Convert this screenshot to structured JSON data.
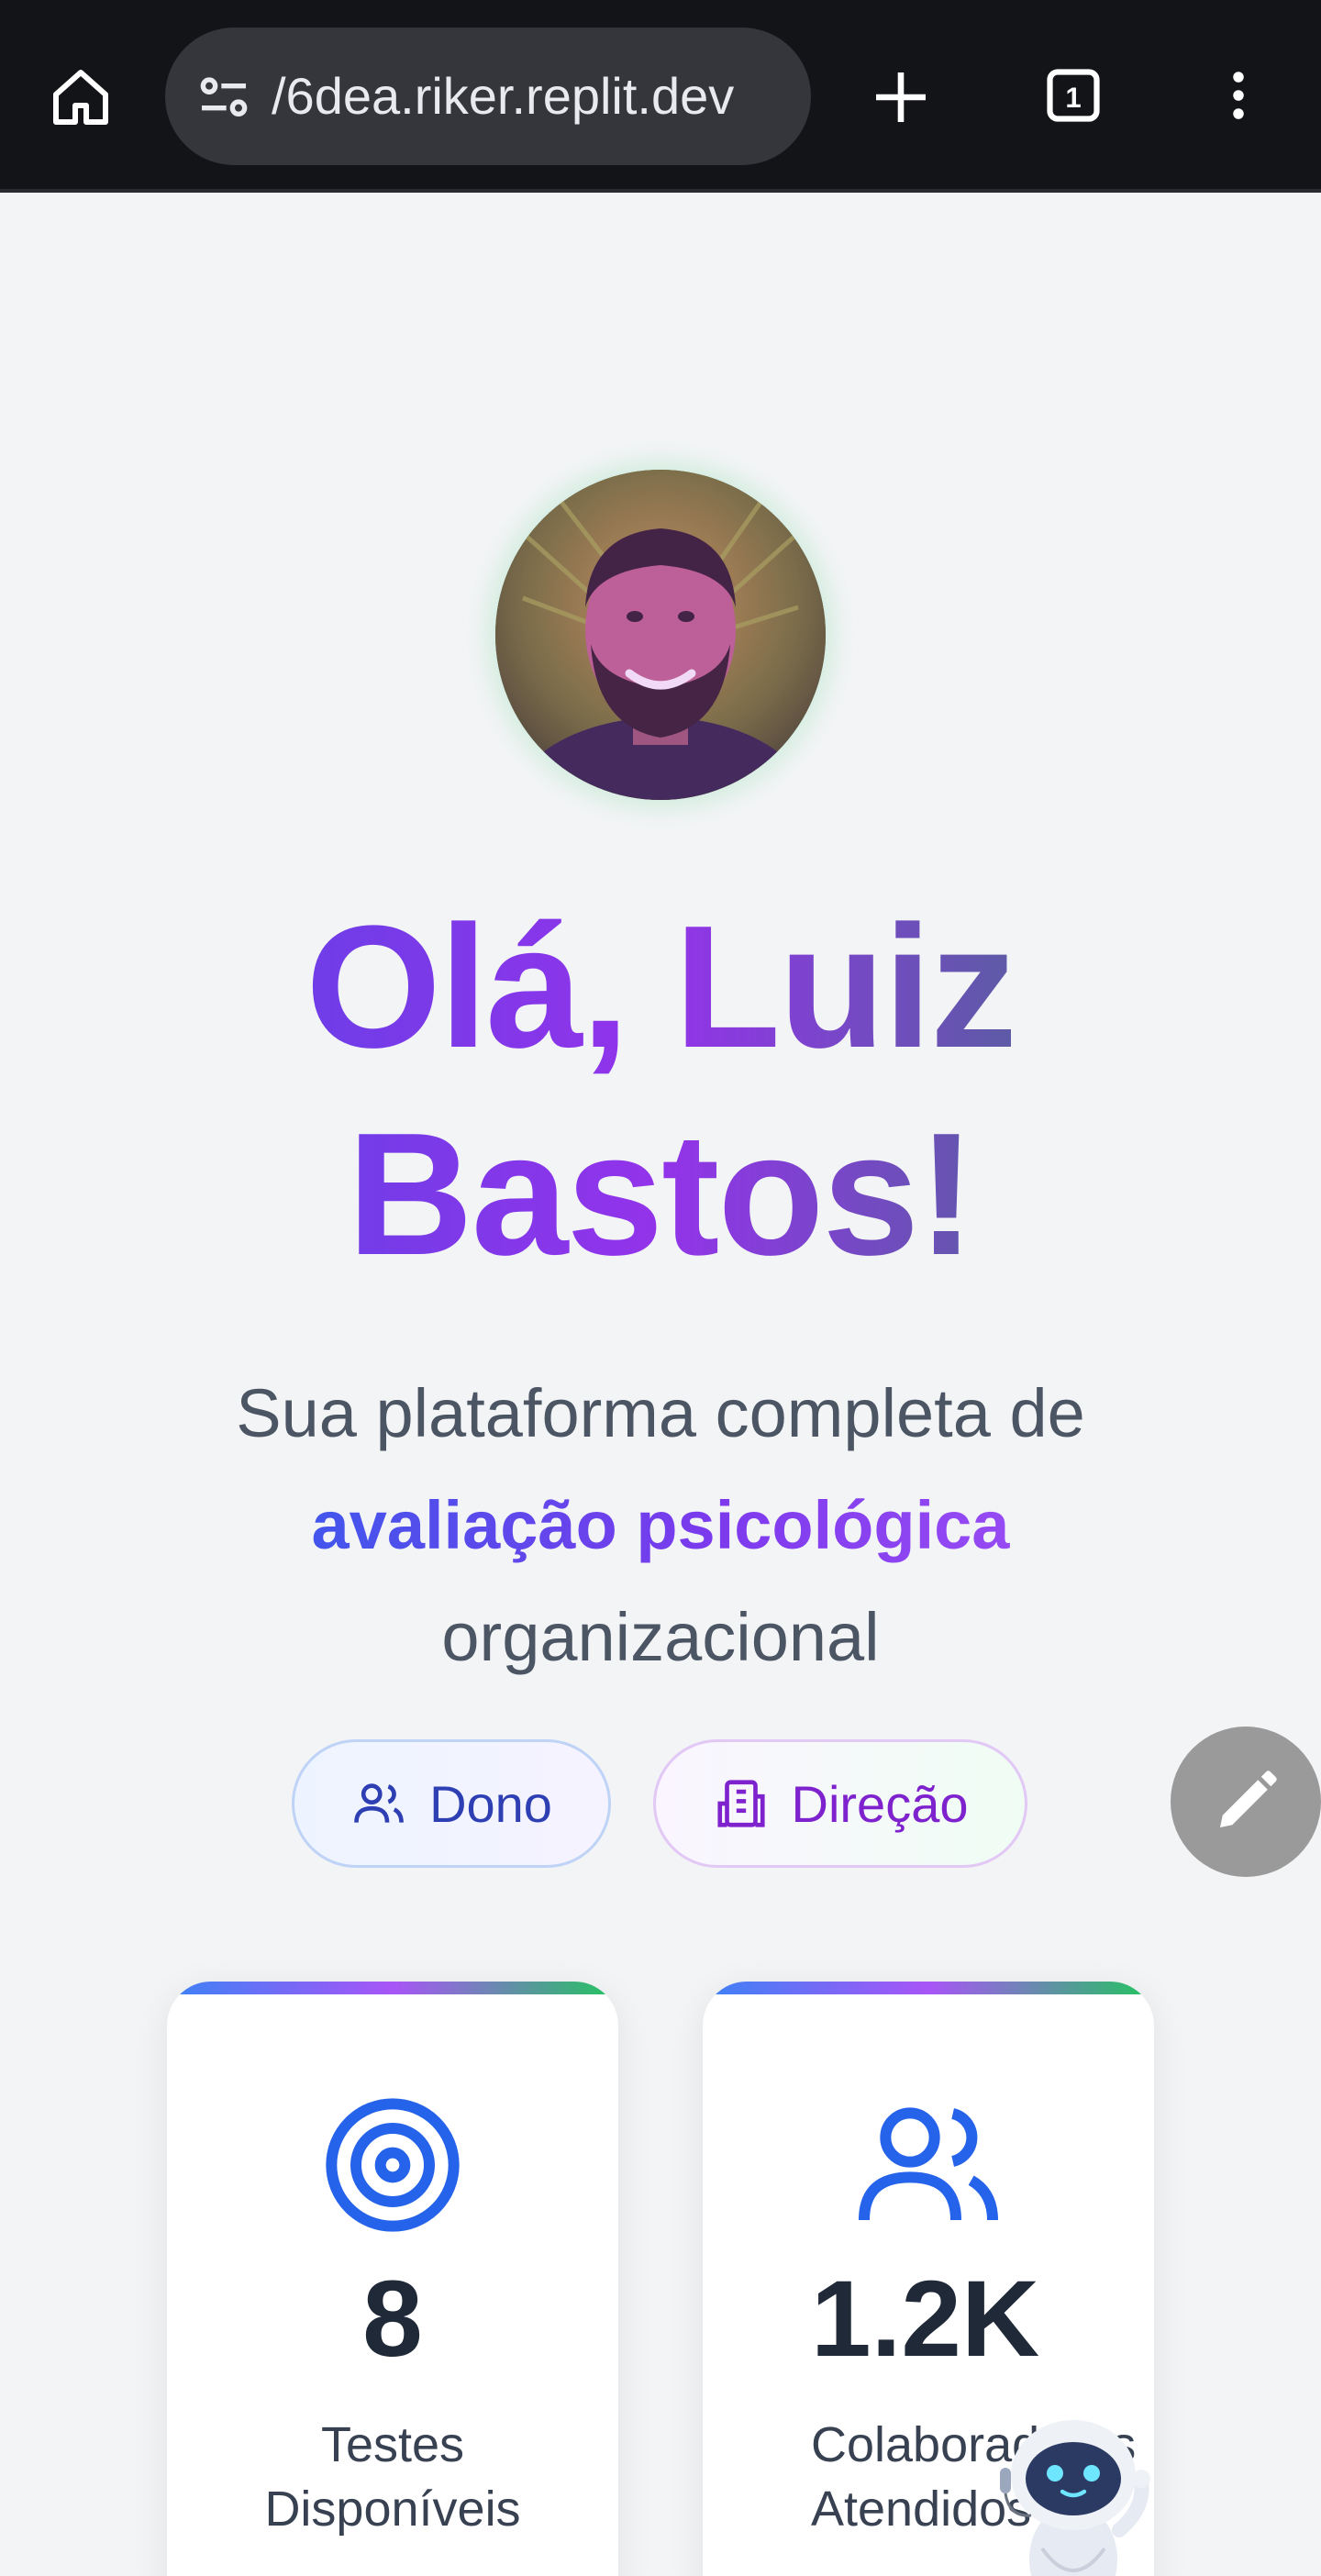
{
  "browser": {
    "url": "/6dea.riker.replit.dev",
    "tab_count": "1"
  },
  "profile": {
    "greeting_line1": "Olá, Luiz",
    "greeting_line2": "Bastos!",
    "subtitle_line1": "Sua plataforma completa de",
    "subtitle_highlight": "avaliação psicológica",
    "subtitle_line3": "organizacional"
  },
  "roles": [
    {
      "label": "Dono",
      "icon": "users-icon"
    },
    {
      "label": "Direção",
      "icon": "building-icon"
    }
  ],
  "stats": [
    {
      "value": "8",
      "label_line1": "Testes",
      "label_line2": "Disponíveis",
      "icon": "target-icon"
    },
    {
      "value": "1.2K",
      "label_line1": "Colaboradores",
      "label_line2": "Atendidos",
      "icon": "users-icon"
    }
  ],
  "colors": {
    "accent_blue": "#4f46e5",
    "accent_purple": "#9333ea",
    "accent_green": "#22c55e"
  }
}
